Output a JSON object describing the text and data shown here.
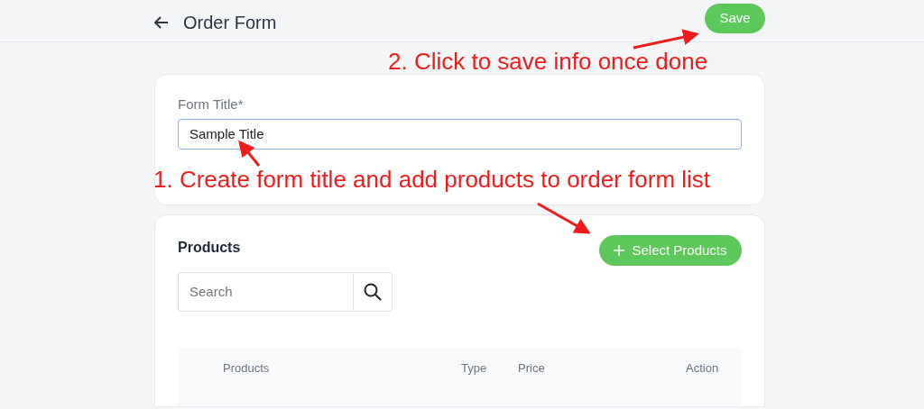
{
  "header": {
    "title": "Order Form",
    "save_button": "Save"
  },
  "form_title": {
    "label": "Form Title*",
    "value": "Sample Title"
  },
  "products": {
    "title": "Products",
    "select_button": "Select Products",
    "search": {
      "placeholder": "Search"
    },
    "table": {
      "columns": [
        "Products",
        "Type",
        "Price",
        "Action"
      ]
    }
  },
  "annotations": [
    {
      "text": "2. Click to save info once done"
    },
    {
      "text": "1. Create form title and add products to order form list"
    }
  ]
}
